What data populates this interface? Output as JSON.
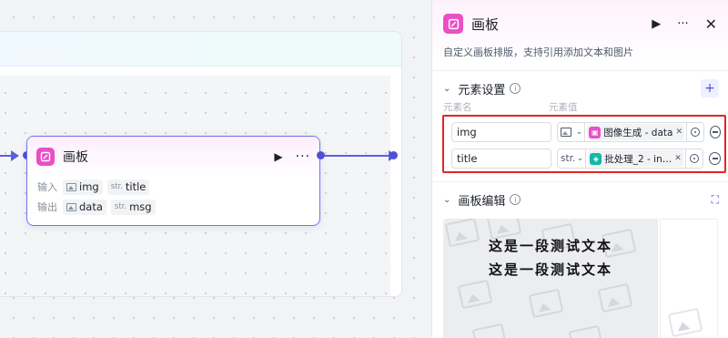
{
  "canvas": {
    "node": {
      "title": "画板",
      "input_label": "输入",
      "output_label": "输出",
      "inputs": [
        {
          "type": "image",
          "name": "img"
        },
        {
          "type": "str",
          "name": "title"
        }
      ],
      "outputs": [
        {
          "type": "image",
          "name": "data"
        },
        {
          "type": "str",
          "name": "msg"
        }
      ]
    }
  },
  "panel": {
    "title": "画板",
    "description": "自定义画板排版，支持引用添加文本和图片",
    "elements_section": {
      "title": "元素设置",
      "col_name": "元素名",
      "col_value": "元素值",
      "rows": [
        {
          "name": "img",
          "type_label": "",
          "type_icon": "image-icon",
          "ref_icon_color": "#e94fc7",
          "ref_text": "图像生成 - data"
        },
        {
          "name": "title",
          "type_label": "str.",
          "type_icon": "",
          "ref_icon_color": "#14b8a6",
          "ref_text": "批处理_2 - in…"
        }
      ]
    },
    "editor_section": {
      "title": "画板编辑",
      "lines": [
        "这是一段测试文本",
        "这是一段测试文本"
      ]
    }
  },
  "str_mark": "str.",
  "colors": {
    "accent": "#4e4fd8",
    "brand_pink": "#e94fc7",
    "highlight_red": "#e02525"
  }
}
